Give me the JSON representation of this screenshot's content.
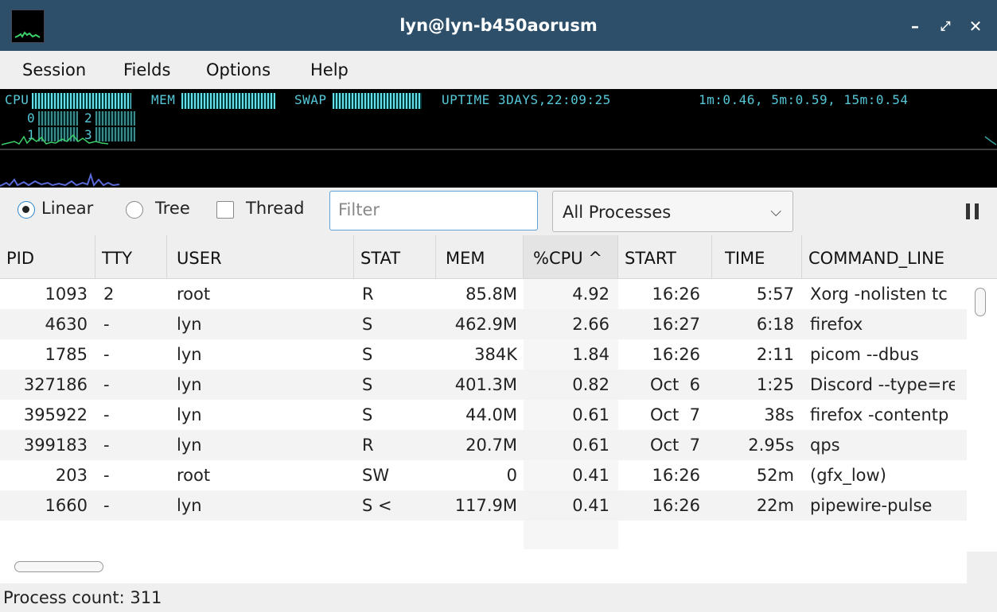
{
  "window": {
    "title": "lyn@lyn-b450aorusm"
  },
  "menu": [
    "Session",
    "Fields",
    "Options",
    "Help"
  ],
  "monitor": {
    "cpu_label": "CPU",
    "mem_label": "MEM",
    "swap_label": "SWAP",
    "uptime": "UPTIME 3DAYS,22:09:25",
    "load": "1m:0.46, 5m:0.59, 15m:0.54",
    "cores": [
      "0",
      "2",
      "1",
      "3"
    ]
  },
  "toolbar": {
    "linear": "Linear",
    "tree": "Tree",
    "thread": "Thread",
    "filter_placeholder": "Filter",
    "process_filter": "All Processes"
  },
  "columns": [
    "PID",
    "TTY",
    "USER",
    "STAT",
    "MEM",
    "%CPU ^",
    "START",
    "TIME",
    "COMMAND_LINE"
  ],
  "rows": [
    [
      "1093",
      "2",
      "root",
      "R",
      "85.8M",
      "4.92",
      "16:26",
      "5:57",
      "Xorg -nolisten tc"
    ],
    [
      "4630",
      "-",
      "lyn",
      "S",
      "462.9M",
      "2.66",
      "16:27",
      "6:18",
      "firefox"
    ],
    [
      "1785",
      "-",
      "lyn",
      "S",
      "384K",
      "1.84",
      "16:26",
      "2:11",
      "picom --dbus"
    ],
    [
      "327186",
      "-",
      "lyn",
      "S",
      "401.3M",
      "0.82",
      "Oct  6",
      "1:25",
      "Discord --type=re"
    ],
    [
      "395922",
      "-",
      "lyn",
      "S",
      "44.0M",
      "0.61",
      "Oct  7",
      "38s",
      "firefox -contentp"
    ],
    [
      "399183",
      "-",
      "lyn",
      "R",
      "20.7M",
      "0.61",
      "Oct  7",
      "2.95s",
      "qps"
    ],
    [
      "203",
      "-",
      "root",
      "SW",
      "0",
      "0.41",
      "16:26",
      "52m",
      "(gfx_low)"
    ],
    [
      "1660",
      "-",
      "lyn",
      "S <",
      "117.9M",
      "0.41",
      "16:26",
      "22m",
      "pipewire-pulse"
    ]
  ],
  "status": {
    "process_count": "Process count: 311"
  }
}
